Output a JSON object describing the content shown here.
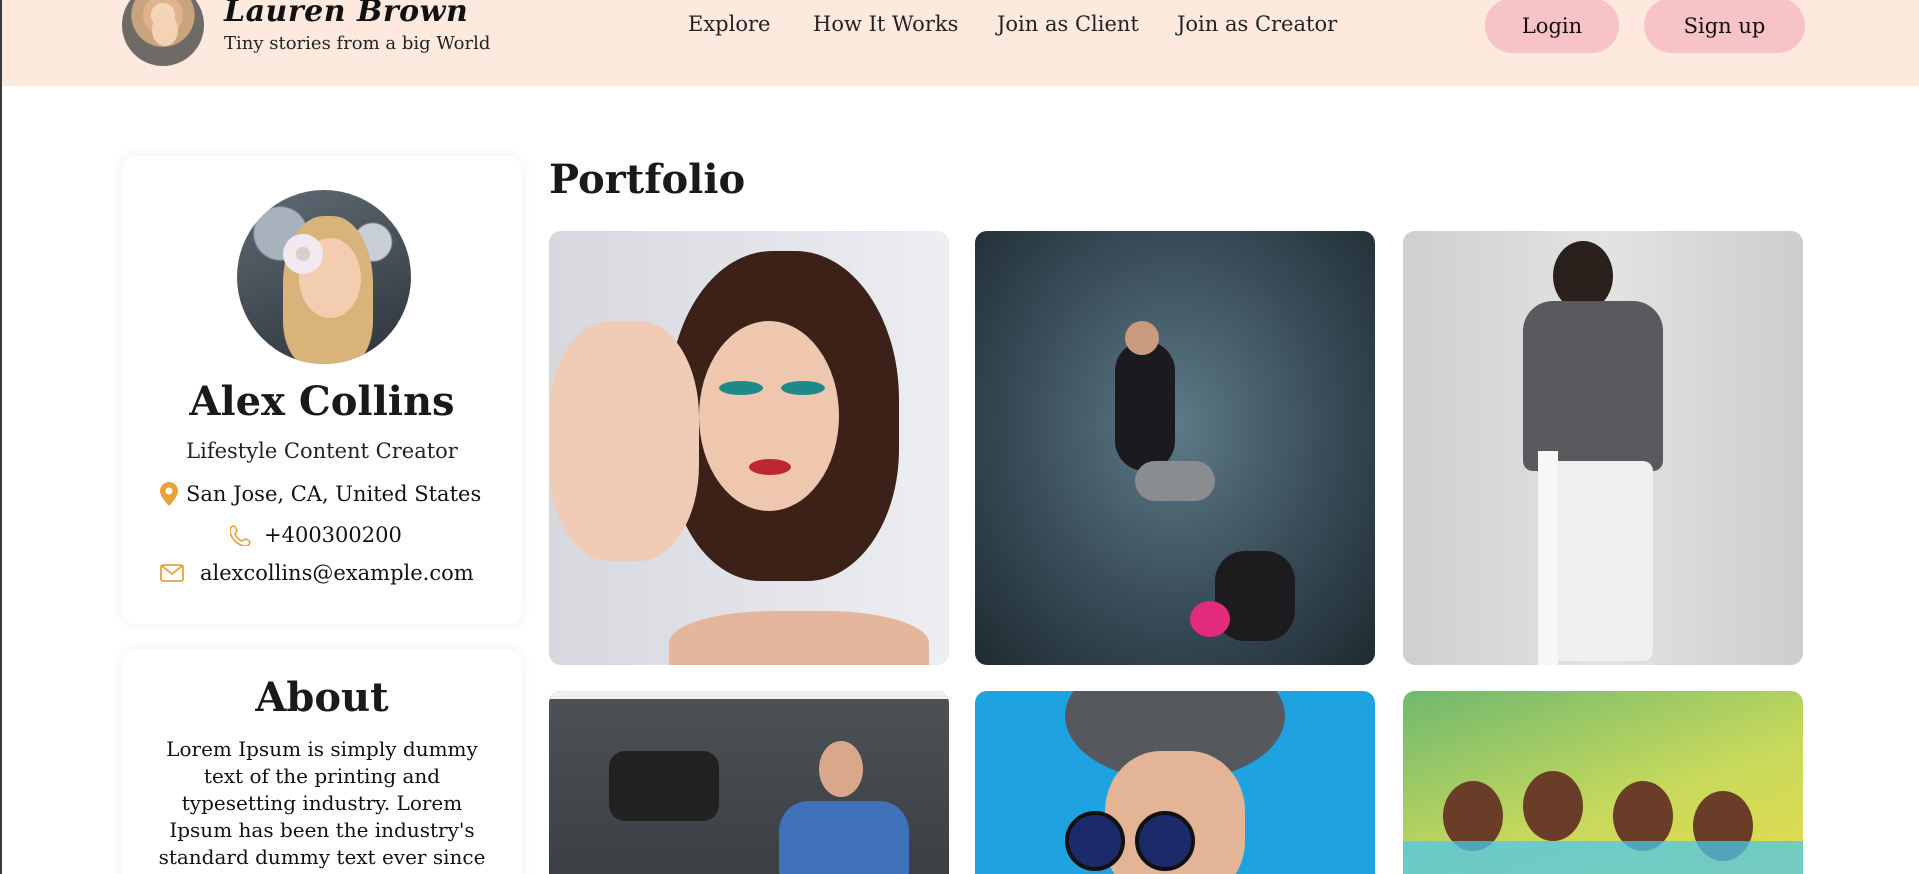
{
  "header": {
    "brand_name": "Lauren Brown",
    "brand_tagline": "Tiny stories from a big World",
    "nav": [
      "Explore",
      "How It Works",
      "Join as Client",
      "Join as Creator"
    ],
    "login_label": "Login",
    "signup_label": "Sign up"
  },
  "profile": {
    "name": "Alex Collins",
    "role": "Lifestyle Content Creator",
    "location": "San Jose, CA, United States",
    "phone": "+400300200",
    "email": "alexcollins@example.com"
  },
  "about": {
    "title": "About",
    "text": "Lorem Ipsum is simply dummy text of the printing and typesetting industry. Lorem Ipsum has been the industry's standard dummy text ever since"
  },
  "portfolio": {
    "title": "Portfolio",
    "tiles": 6
  },
  "colors": {
    "header_bg": "#fde9dd",
    "button_bg": "#f8c3c6",
    "icon_accent": "#e8a23a"
  },
  "icons": {
    "location": "map-pin-icon",
    "phone": "phone-icon",
    "email": "mail-icon"
  }
}
